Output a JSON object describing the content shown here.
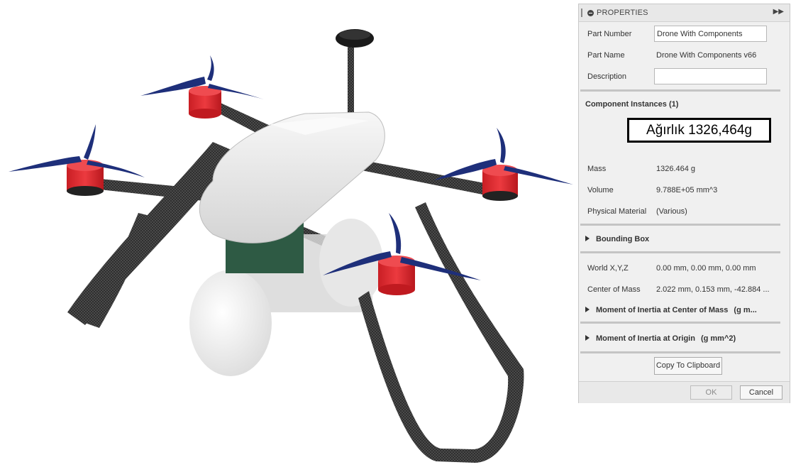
{
  "panel": {
    "title": "PROPERTIES",
    "part_number_label": "Part Number",
    "part_number_value": "Drone With Components",
    "part_name_label": "Part Name",
    "part_name_value": "Drone With Components v66",
    "description_label": "Description",
    "description_value": "",
    "component_instances": "Component Instances (1)",
    "mass_label": "Mass",
    "mass_value": "1326.464 g",
    "volume_label": "Volume",
    "volume_value": "9.788E+05 mm^3",
    "material_label": "Physical Material",
    "material_value": "(Various)",
    "bounding_box": "Bounding Box",
    "world_label": "World X,Y,Z",
    "world_value": "0.00 mm, 0.00 mm, 0.00 mm",
    "com_label": "Center of Mass",
    "com_value": "2.022 mm, 0.153 mm, -42.884 ...",
    "moi_center": "Moment of Inertia at Center of Mass",
    "moi_center_unit": "(g m...",
    "moi_origin": "Moment of Inertia at Origin",
    "moi_origin_unit": "(g mm^2)",
    "copy_button": "Copy To Clipboard",
    "ok_button": "OK",
    "cancel_button": "Cancel"
  },
  "annotation": {
    "text": "Ağırlık 1326,464g"
  },
  "colors": {
    "motor_red": "#e0262c",
    "propeller_blue": "#1e2f7a",
    "carbon": "#2a2a2a",
    "canopy": "#eeeeee",
    "battery_green": "#2e5a44"
  }
}
